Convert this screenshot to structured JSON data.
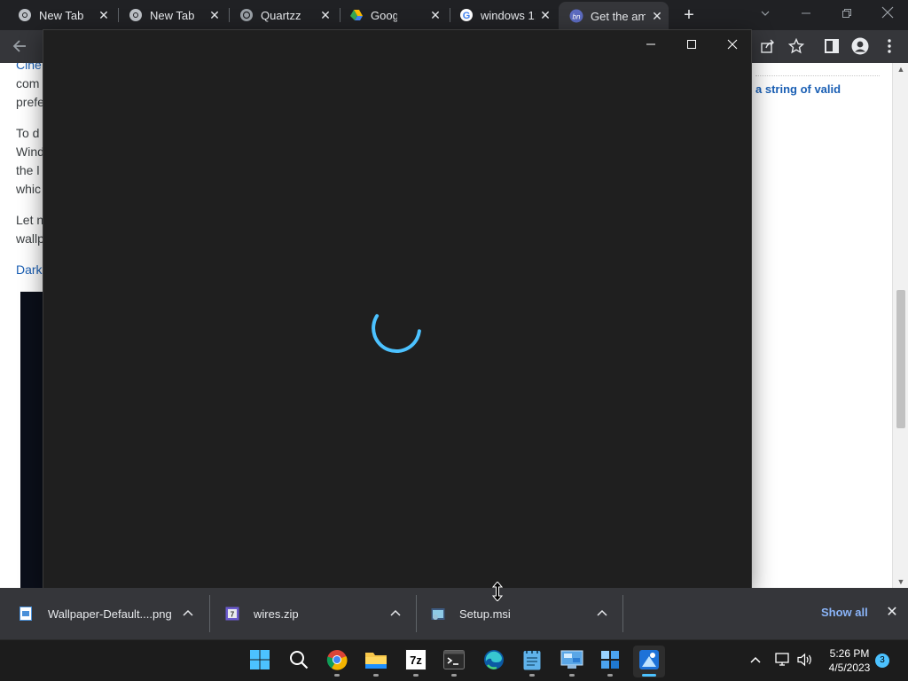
{
  "browser": {
    "tabs": [
      {
        "title": "New Tab",
        "icon": "chrome-icon"
      },
      {
        "title": "New Tab",
        "icon": "chrome-icon"
      },
      {
        "title": "Quartzz",
        "icon": "globe-icon"
      },
      {
        "title": "Google Dri",
        "icon": "google-drive-icon"
      },
      {
        "title": "windows 1:",
        "icon": "google-icon"
      },
      {
        "title": "Get the am",
        "icon": "site-favicon",
        "active": true
      }
    ],
    "close_glyph": "✕",
    "new_tab_glyph": "+"
  },
  "page": {
    "paragraphs": [
      {
        "text": "Cine",
        "link": true
      },
      {
        "text": "com"
      },
      {
        "text": "prefe"
      },
      {
        "text": "To d"
      },
      {
        "text": "Wind"
      },
      {
        "text": "the l"
      },
      {
        "text": "whic"
      },
      {
        "text": "Let n"
      },
      {
        "text": "wallp"
      },
      {
        "text": "Dark",
        "link": true
      }
    ],
    "right_snippet": "a string of valid"
  },
  "app_window": {
    "state": "loading",
    "spinner_color": "#4cc2ff",
    "background": "#1f1f1f"
  },
  "downloads": {
    "items": [
      {
        "name": "Wallpaper-Default....png",
        "icon": "image-file-icon"
      },
      {
        "name": "wires.zip",
        "icon": "zip-file-icon"
      },
      {
        "name": "Setup.msi",
        "icon": "installer-file-icon"
      }
    ],
    "show_all": "Show all",
    "close_glyph": "✕"
  },
  "taskbar": {
    "apps": [
      {
        "name": "start",
        "icon": "windows-logo-icon"
      },
      {
        "name": "search",
        "icon": "search-icon"
      },
      {
        "name": "chrome",
        "icon": "chrome-icon"
      },
      {
        "name": "file-explorer",
        "icon": "folder-icon"
      },
      {
        "name": "7zip",
        "icon": "7zip-icon",
        "label": "7z"
      },
      {
        "name": "terminal",
        "icon": "terminal-icon"
      },
      {
        "name": "edge",
        "icon": "edge-icon"
      },
      {
        "name": "notepad",
        "icon": "notepad-icon"
      },
      {
        "name": "control-panel",
        "icon": "control-panel-icon"
      },
      {
        "name": "app-installer",
        "icon": "app-installer-icon"
      },
      {
        "name": "snipping-tool",
        "icon": "snipping-tool-icon",
        "active": true
      }
    ],
    "time": "5:26 PM",
    "date": "4/5/2023",
    "notification_count": "3"
  }
}
